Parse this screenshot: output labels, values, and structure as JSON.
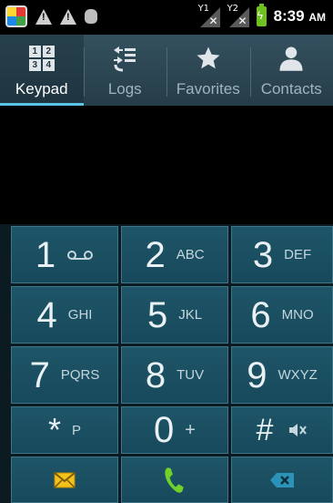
{
  "status_bar": {
    "time": "8:39",
    "ampm": "AM",
    "sim1": "1",
    "sim2": "2"
  },
  "tabs": [
    {
      "label": "Keypad",
      "icon": "keypad-icon",
      "active": true
    },
    {
      "label": "Logs",
      "icon": "logs-icon",
      "active": false
    },
    {
      "label": "Favorites",
      "icon": "star-icon",
      "active": false
    },
    {
      "label": "Contacts",
      "icon": "person-icon",
      "active": false
    }
  ],
  "keypad_icon_digits": [
    "1",
    "2",
    "3",
    "4"
  ],
  "display": {
    "number": ""
  },
  "keys": {
    "k1": {
      "digit": "1",
      "letters": "",
      "icon": "voicemail-icon"
    },
    "k2": {
      "digit": "2",
      "letters": "ABC"
    },
    "k3": {
      "digit": "3",
      "letters": "DEF"
    },
    "k4": {
      "digit": "4",
      "letters": "GHI"
    },
    "k5": {
      "digit": "5",
      "letters": "JKL"
    },
    "k6": {
      "digit": "6",
      "letters": "MNO"
    },
    "k7": {
      "digit": "7",
      "letters": "PQRS"
    },
    "k8": {
      "digit": "8",
      "letters": "TUV"
    },
    "k9": {
      "digit": "9",
      "letters": "WXYZ"
    },
    "kstar": {
      "digit": "*",
      "letters": "P"
    },
    "k0": {
      "digit": "0",
      "letters": "+"
    },
    "khash": {
      "digit": "#",
      "icon": "silent-mode-icon"
    }
  },
  "actions": {
    "message": "message-icon",
    "call": "call-icon",
    "backspace": "backspace-icon"
  },
  "colors": {
    "key_bg": "#1b5063",
    "key_border": "#3f7788",
    "active_tab_indicator": "#5cc2e8",
    "call_green": "#6fd12a",
    "message_yellow": "#f2c21b"
  }
}
